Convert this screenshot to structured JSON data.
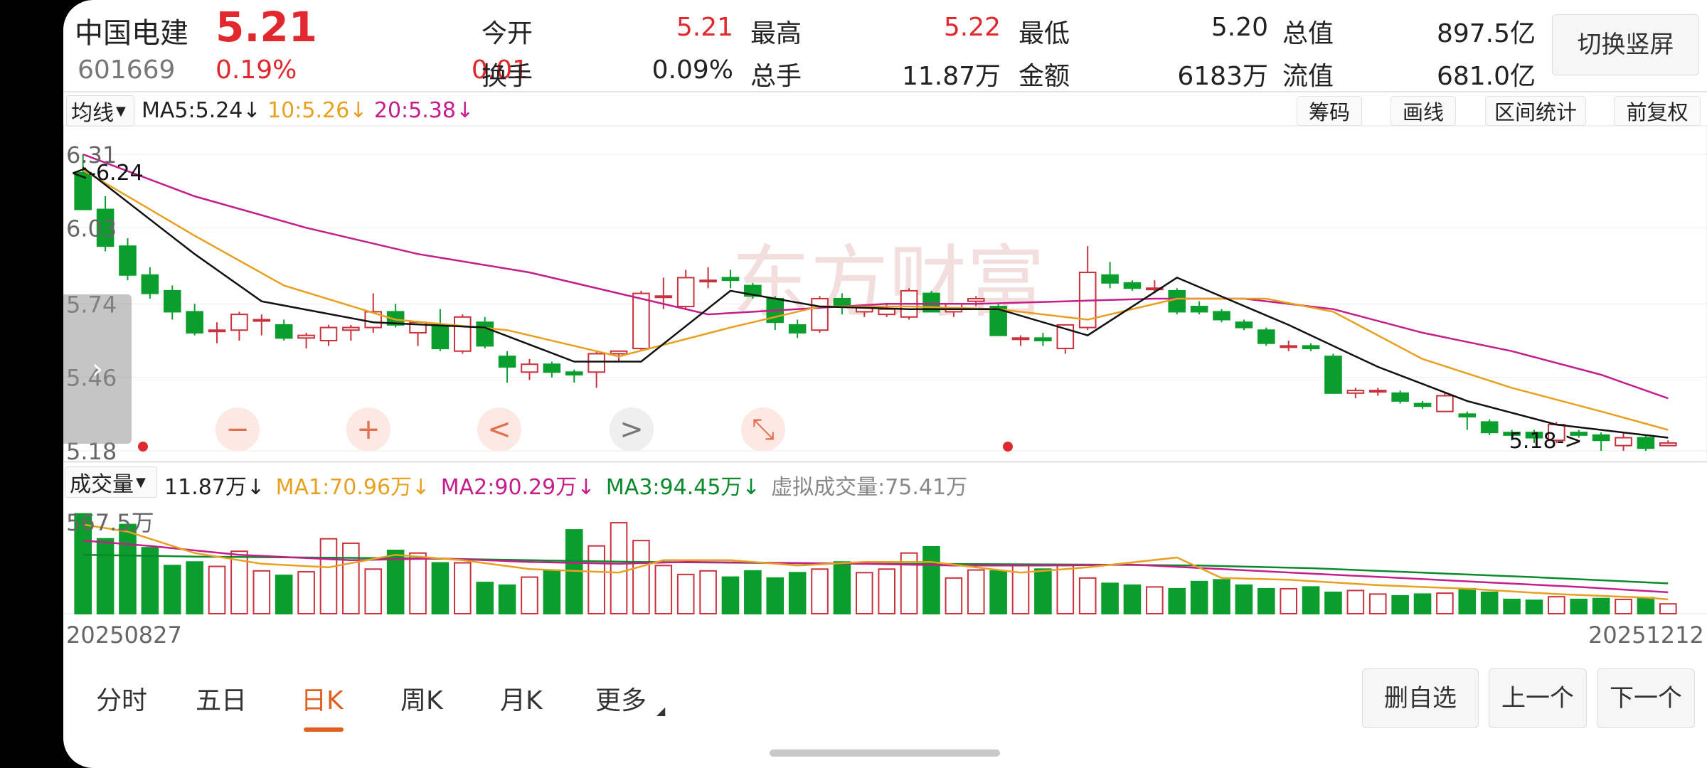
{
  "quote": {
    "name": "中国电建",
    "price": "5.21",
    "code": "601669",
    "change_pct": "0.19%",
    "change": "0.01",
    "fields": [
      {
        "label": "今开",
        "value": "5.21",
        "color": "red"
      },
      {
        "label": "最高",
        "value": "5.22",
        "color": "red"
      },
      {
        "label": "最低",
        "value": "5.20",
        "color": "dark"
      },
      {
        "label": "总值",
        "value": "897.5亿",
        "color": "dark"
      },
      {
        "label": "换手",
        "value": "0.09%",
        "color": "dark"
      },
      {
        "label": "总手",
        "value": "11.87万",
        "color": "dark"
      },
      {
        "label": "金额",
        "value": "6183万",
        "color": "dark"
      },
      {
        "label": "流值",
        "value": "681.0亿",
        "color": "dark"
      }
    ],
    "switch_button": "切换竖屏"
  },
  "ma_bar": {
    "selector": "均线",
    "ma5": "MA5:5.24↓",
    "ma10": "10:5.26↓",
    "ma20": "20:5.38↓",
    "buttons": [
      "筹码",
      "画线",
      "区间统计",
      "前复权"
    ]
  },
  "vol_bar": {
    "selector": "成交量",
    "vol": "11.87万↓",
    "ma1": "MA1:70.96万↓",
    "ma2": "MA2:90.29万↓",
    "ma3": "MA3:94.45万↓",
    "virtual": "虚拟成交量:75.41万"
  },
  "chart_data": {
    "type": "candlestick",
    "price_axis_labels": [
      "6.31",
      "6.03",
      "5.74",
      "5.46",
      "5.18"
    ],
    "ylim": [
      5.18,
      6.31
    ],
    "max_annotation": "<-6.24",
    "min_annotation": "5.18->",
    "volume_axis_label": "567.5万",
    "date_start": "20250827",
    "date_end": "20251212",
    "colors": {
      "up": "#c8323c",
      "down": "#0a9e2c",
      "ma5": "#111111",
      "ma10": "#e8a020",
      "ma20": "#c41e8a",
      "vma1": "#e8a020",
      "vma2": "#c41e8a",
      "vma3": "#0a8a2a"
    },
    "candles": [
      [
        6.24,
        6.31,
        6.17,
        6.1
      ],
      [
        6.1,
        6.15,
        5.94,
        5.96
      ],
      [
        5.96,
        5.99,
        5.83,
        5.85
      ],
      [
        5.85,
        5.88,
        5.76,
        5.78
      ],
      [
        5.79,
        5.81,
        5.68,
        5.71
      ],
      [
        5.71,
        5.74,
        5.62,
        5.63
      ],
      [
        5.64,
        5.67,
        5.59,
        5.64
      ],
      [
        5.64,
        5.71,
        5.6,
        5.7
      ],
      [
        5.68,
        5.7,
        5.62,
        5.68
      ],
      [
        5.66,
        5.68,
        5.6,
        5.61
      ],
      [
        5.61,
        5.63,
        5.57,
        5.62
      ],
      [
        5.6,
        5.66,
        5.58,
        5.65
      ],
      [
        5.64,
        5.66,
        5.6,
        5.65
      ],
      [
        5.65,
        5.78,
        5.63,
        5.71
      ],
      [
        5.71,
        5.74,
        5.65,
        5.66
      ],
      [
        5.63,
        5.67,
        5.58,
        5.67
      ],
      [
        5.66,
        5.72,
        5.56,
        5.57
      ],
      [
        5.56,
        5.7,
        5.55,
        5.69
      ],
      [
        5.67,
        5.69,
        5.57,
        5.58
      ],
      [
        5.54,
        5.56,
        5.44,
        5.5
      ],
      [
        5.48,
        5.53,
        5.45,
        5.51
      ],
      [
        5.51,
        5.52,
        5.46,
        5.48
      ],
      [
        5.48,
        5.49,
        5.44,
        5.47
      ],
      [
        5.48,
        5.56,
        5.42,
        5.55
      ],
      [
        5.55,
        5.56,
        5.52,
        5.56
      ],
      [
        5.57,
        5.79,
        5.56,
        5.78
      ],
      [
        5.77,
        5.84,
        5.72,
        5.77
      ],
      [
        5.73,
        5.87,
        5.72,
        5.84
      ],
      [
        5.83,
        5.88,
        5.8,
        5.83
      ],
      [
        5.84,
        5.87,
        5.8,
        5.83
      ],
      [
        5.81,
        5.82,
        5.76,
        5.77
      ],
      [
        5.76,
        5.77,
        5.64,
        5.67
      ],
      [
        5.66,
        5.68,
        5.61,
        5.63
      ],
      [
        5.64,
        5.77,
        5.63,
        5.76
      ],
      [
        5.76,
        5.78,
        5.7,
        5.73
      ],
      [
        5.71,
        5.73,
        5.69,
        5.73
      ],
      [
        5.7,
        5.74,
        5.69,
        5.72
      ],
      [
        5.69,
        5.8,
        5.68,
        5.79
      ],
      [
        5.78,
        5.79,
        5.71,
        5.71
      ],
      [
        5.71,
        5.74,
        5.69,
        5.74
      ],
      [
        5.75,
        5.77,
        5.73,
        5.76
      ],
      [
        5.73,
        5.74,
        5.62,
        5.62
      ],
      [
        5.61,
        5.62,
        5.58,
        5.61
      ],
      [
        5.61,
        5.63,
        5.58,
        5.6
      ],
      [
        5.57,
        5.66,
        5.55,
        5.66
      ],
      [
        5.65,
        5.96,
        5.64,
        5.86
      ],
      [
        5.85,
        5.9,
        5.8,
        5.82
      ],
      [
        5.82,
        5.83,
        5.79,
        5.8
      ],
      [
        5.8,
        5.83,
        5.78,
        5.8
      ],
      [
        5.79,
        5.8,
        5.7,
        5.71
      ],
      [
        5.73,
        5.75,
        5.7,
        5.71
      ],
      [
        5.71,
        5.72,
        5.67,
        5.68
      ],
      [
        5.67,
        5.68,
        5.64,
        5.65
      ],
      [
        5.64,
        5.65,
        5.58,
        5.59
      ],
      [
        5.58,
        5.6,
        5.56,
        5.58
      ],
      [
        5.58,
        5.59,
        5.56,
        5.57
      ],
      [
        5.54,
        5.55,
        5.4,
        5.4
      ],
      [
        5.4,
        5.42,
        5.38,
        5.41
      ],
      [
        5.41,
        5.42,
        5.39,
        5.41
      ],
      [
        5.4,
        5.41,
        5.36,
        5.37
      ],
      [
        5.36,
        5.37,
        5.34,
        5.35
      ],
      [
        5.33,
        5.4,
        5.33,
        5.39
      ],
      [
        5.32,
        5.33,
        5.26,
        5.31
      ],
      [
        5.29,
        5.3,
        5.24,
        5.25
      ],
      [
        5.25,
        5.26,
        5.22,
        5.24
      ],
      [
        5.25,
        5.26,
        5.21,
        5.23
      ],
      [
        5.22,
        5.29,
        5.21,
        5.28
      ],
      [
        5.25,
        5.26,
        5.23,
        5.24
      ],
      [
        5.24,
        5.25,
        5.18,
        5.22
      ],
      [
        5.2,
        5.25,
        5.18,
        5.23
      ],
      [
        5.23,
        5.24,
        5.18,
        5.19
      ],
      [
        5.2,
        5.22,
        5.2,
        5.21
      ]
    ],
    "volumes": [
      560,
      420,
      500,
      370,
      270,
      290,
      265,
      350,
      240,
      215,
      235,
      420,
      395,
      250,
      355,
      340,
      285,
      285,
      175,
      160,
      205,
      240,
      470,
      380,
      510,
      410,
      270,
      220,
      240,
      205,
      240,
      200,
      230,
      250,
      290,
      230,
      250,
      340,
      375,
      200,
      245,
      240,
      270,
      250,
      270,
      200,
      170,
      160,
      150,
      140,
      180,
      190,
      160,
      140,
      140,
      150,
      120,
      130,
      110,
      100,
      110,
      115,
      140,
      120,
      80,
      75,
      95,
      80,
      85,
      80,
      90,
      55
    ],
    "ma_lines": {
      "ma5": [
        [
          0,
          6.26
        ],
        [
          5,
          5.93
        ],
        [
          8,
          5.75
        ],
        [
          13,
          5.67
        ],
        [
          18,
          5.65
        ],
        [
          22,
          5.52
        ],
        [
          25,
          5.52
        ],
        [
          29,
          5.79
        ],
        [
          33,
          5.73
        ],
        [
          37,
          5.72
        ],
        [
          41,
          5.72
        ],
        [
          45,
          5.62
        ],
        [
          49,
          5.84
        ],
        [
          54,
          5.66
        ],
        [
          58,
          5.5
        ],
        [
          62,
          5.37
        ],
        [
          66,
          5.28
        ],
        [
          70,
          5.24
        ],
        [
          71,
          5.23
        ]
      ],
      "ma10": [
        [
          0,
          6.25
        ],
        [
          5,
          6.0
        ],
        [
          9,
          5.81
        ],
        [
          14,
          5.68
        ],
        [
          19,
          5.64
        ],
        [
          24,
          5.54
        ],
        [
          29,
          5.65
        ],
        [
          33,
          5.73
        ],
        [
          37,
          5.73
        ],
        [
          41,
          5.72
        ],
        [
          45,
          5.68
        ],
        [
          49,
          5.76
        ],
        [
          53,
          5.76
        ],
        [
          56,
          5.71
        ],
        [
          60,
          5.53
        ],
        [
          64,
          5.42
        ],
        [
          68,
          5.33
        ],
        [
          71,
          5.26
        ]
      ],
      "ma20": [
        [
          0,
          6.31
        ],
        [
          5,
          6.15
        ],
        [
          10,
          6.03
        ],
        [
          15,
          5.93
        ],
        [
          20,
          5.86
        ],
        [
          24,
          5.78
        ],
        [
          28,
          5.7
        ],
        [
          32,
          5.72
        ],
        [
          36,
          5.74
        ],
        [
          40,
          5.74
        ],
        [
          44,
          5.75
        ],
        [
          48,
          5.76
        ],
        [
          52,
          5.76
        ],
        [
          56,
          5.72
        ],
        [
          60,
          5.63
        ],
        [
          64,
          5.56
        ],
        [
          68,
          5.47
        ],
        [
          71,
          5.38
        ]
      ],
      "vma1": [
        [
          0,
          500
        ],
        [
          2,
          460
        ],
        [
          5,
          340
        ],
        [
          8,
          280
        ],
        [
          11,
          260
        ],
        [
          14,
          330
        ],
        [
          17,
          300
        ],
        [
          20,
          250
        ],
        [
          24,
          230
        ],
        [
          26,
          300
        ],
        [
          29,
          300
        ],
        [
          32,
          270
        ],
        [
          35,
          290
        ],
        [
          38,
          290
        ],
        [
          42,
          230
        ],
        [
          45,
          260
        ],
        [
          49,
          315
        ],
        [
          51,
          200
        ],
        [
          54,
          190
        ],
        [
          58,
          160
        ],
        [
          62,
          140
        ],
        [
          66,
          110
        ],
        [
          70,
          90
        ],
        [
          71,
          80
        ]
      ],
      "vma2": [
        [
          0,
          410
        ],
        [
          3,
          380
        ],
        [
          7,
          330
        ],
        [
          12,
          300
        ],
        [
          16,
          310
        ],
        [
          20,
          290
        ],
        [
          24,
          280
        ],
        [
          27,
          290
        ],
        [
          31,
          285
        ],
        [
          35,
          280
        ],
        [
          39,
          270
        ],
        [
          43,
          270
        ],
        [
          47,
          275
        ],
        [
          51,
          250
        ],
        [
          55,
          225
        ],
        [
          59,
          200
        ],
        [
          63,
          175
        ],
        [
          67,
          150
        ],
        [
          71,
          120
        ]
      ],
      "vma3": [
        [
          0,
          330
        ],
        [
          5,
          320
        ],
        [
          10,
          315
        ],
        [
          15,
          310
        ],
        [
          20,
          300
        ],
        [
          25,
          290
        ],
        [
          30,
          285
        ],
        [
          35,
          280
        ],
        [
          40,
          278
        ],
        [
          45,
          275
        ],
        [
          50,
          270
        ],
        [
          55,
          255
        ],
        [
          60,
          230
        ],
        [
          65,
          205
        ],
        [
          71,
          170
        ]
      ]
    }
  },
  "controls": {
    "zoom_out": "−",
    "zoom_in": "+",
    "prev": "<",
    "next": ">",
    "shrink": "⤡"
  },
  "tabs": [
    "分时",
    "五日",
    "日K",
    "周K",
    "月K",
    "更多"
  ],
  "active_tab": 2,
  "nav_buttons": [
    "删自选",
    "上一个",
    "下一个"
  ]
}
